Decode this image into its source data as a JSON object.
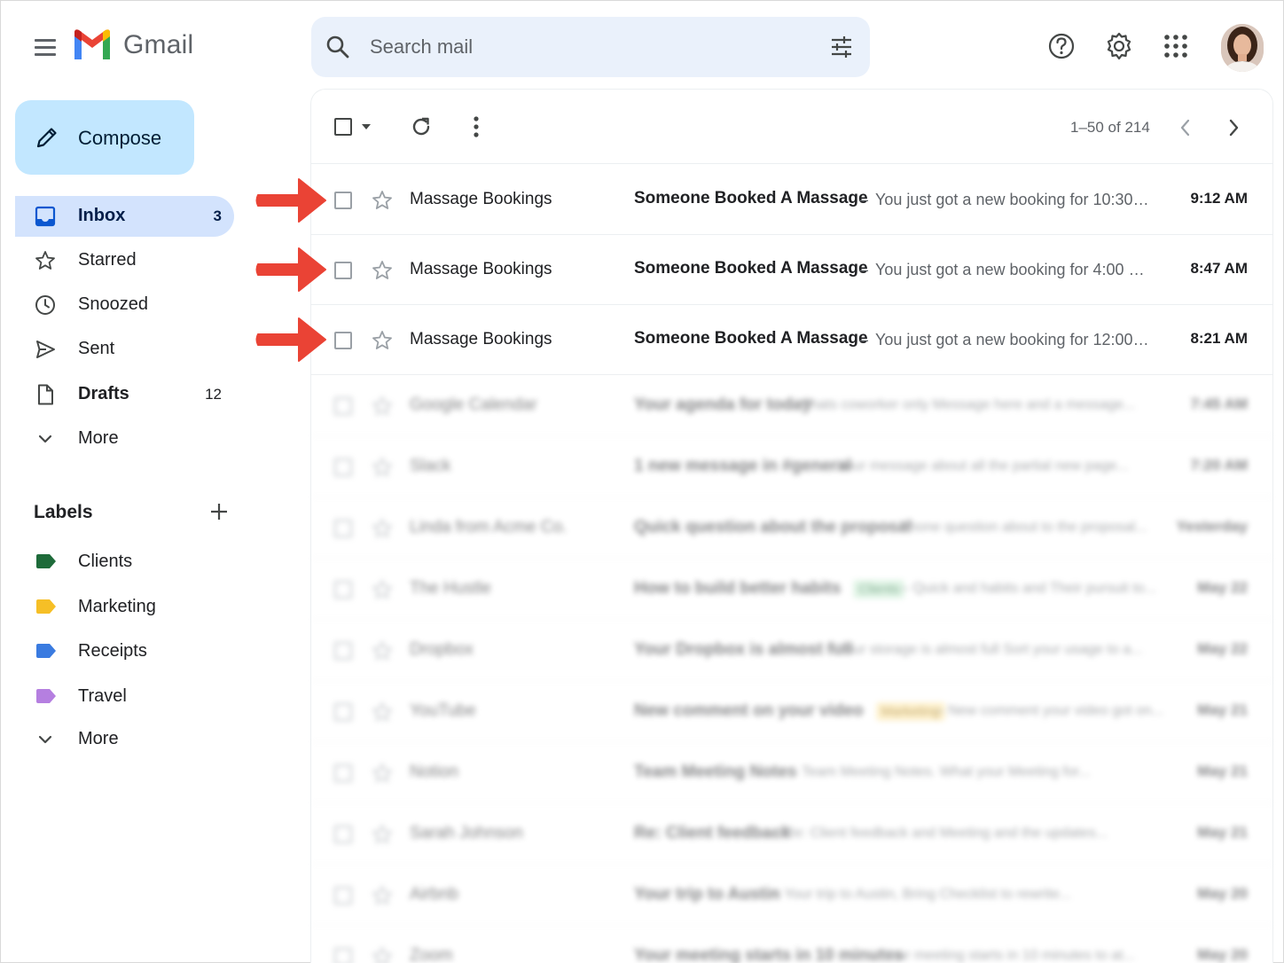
{
  "header": {
    "brand": "Gmail",
    "search_placeholder": "Search mail",
    "icons": [
      "menu-icon",
      "search-icon",
      "tune-icon",
      "help-icon",
      "settings-icon",
      "apps-icon",
      "avatar"
    ]
  },
  "sidebar": {
    "compose_label": "Compose",
    "items": [
      {
        "label": "Inbox",
        "count": "3",
        "icon": "inbox-icon",
        "active": true
      },
      {
        "label": "Starred",
        "count": "",
        "icon": "star-icon"
      },
      {
        "label": "Snoozed",
        "count": "",
        "icon": "clock-icon"
      },
      {
        "label": "Sent",
        "count": "",
        "icon": "send-icon"
      },
      {
        "label": "Drafts",
        "count": "12",
        "icon": "draft-icon"
      },
      {
        "label": "More",
        "count": "",
        "icon": "chevron-down-icon"
      }
    ],
    "labels_title": "Labels",
    "labels": [
      {
        "label": "Clients",
        "color": "#1e6b3a"
      },
      {
        "label": "Marketing",
        "color": "#f6bf26"
      },
      {
        "label": "Receipts",
        "color": "#3a7be0"
      },
      {
        "label": "Travel",
        "color": "#b57fe0"
      }
    ],
    "labels_more": "More"
  },
  "toolbar": {
    "pager": "1–50 of 214"
  },
  "emails": [
    {
      "sender": "Massage Bookings",
      "subject": "Someone Booked A Massage",
      "snippet": "You just got a new booking for 10:30 AM...",
      "time": "9:12 AM"
    },
    {
      "sender": "Massage Bookings",
      "subject": "Someone Booked A Massage",
      "snippet": "You just got a new booking for 4:00 PM...",
      "time": "8:47 AM"
    },
    {
      "sender": "Massage Bookings",
      "subject": "Someone Booked A Massage",
      "snippet": "You just got a new booking for 12:00 PM...",
      "time": "8:21 AM"
    }
  ],
  "blurred_emails": [
    {
      "sender": "Google Calendar",
      "subject": "Your agenda for today",
      "snippet": "Thats coworker only Message here and a message...",
      "time": "7:45 AM"
    },
    {
      "sender": "Slack",
      "subject": "1 new message in #general",
      "snippet": "Your message about all the partial new page...",
      "time": "7:20 AM"
    },
    {
      "sender": "Linda from Acme Co.",
      "subject": "Quick question about the proposal",
      "snippet": "Phone question about to the proposal...",
      "time": "Yesterday"
    },
    {
      "sender": "The Hustle",
      "subject": "How to build better habits",
      "chip": "Clients",
      "chip_bg": "#c8ecd2",
      "chip_fg": "#1e6b3a",
      "snippet": "Quick and habits and Their pursuit to...",
      "time": "May 22"
    },
    {
      "sender": "Dropbox",
      "subject": "Your Dropbox is almost full",
      "snippet": "Your storage is almost full Sort your usage to a...",
      "time": "May 22"
    },
    {
      "sender": "YouTube",
      "subject": "New comment on your video",
      "chip": "Marketing",
      "chip_bg": "#fde7a8",
      "chip_fg": "#9a6a00",
      "snippet": "New comment your video got on...",
      "time": "May 21"
    },
    {
      "sender": "Notion",
      "subject": "Team Meeting Notes",
      "snippet": "Team Meeting Notes. What your Meeting for...",
      "time": "May 21"
    },
    {
      "sender": "Sarah Johnson",
      "subject": "Re: Client feedback",
      "snippet": "Re: Client feedback and Meeting and the updates...",
      "time": "May 21"
    },
    {
      "sender": "Airbnb",
      "subject": "Your trip to Austin",
      "snippet": "Your trip to Austin, Bring Checklist to rewrite...",
      "time": "May 20"
    },
    {
      "sender": "Zoom",
      "subject": "Your meeting starts in 10 minutes",
      "snippet": "Your meeting starts in 10 minutes to at...",
      "time": "May 20"
    }
  ],
  "colors": {
    "accent": "#c2e7ff",
    "active_nav": "#d3e3fd",
    "search_bg": "#eaf1fb",
    "arrow": "#ea4335"
  }
}
